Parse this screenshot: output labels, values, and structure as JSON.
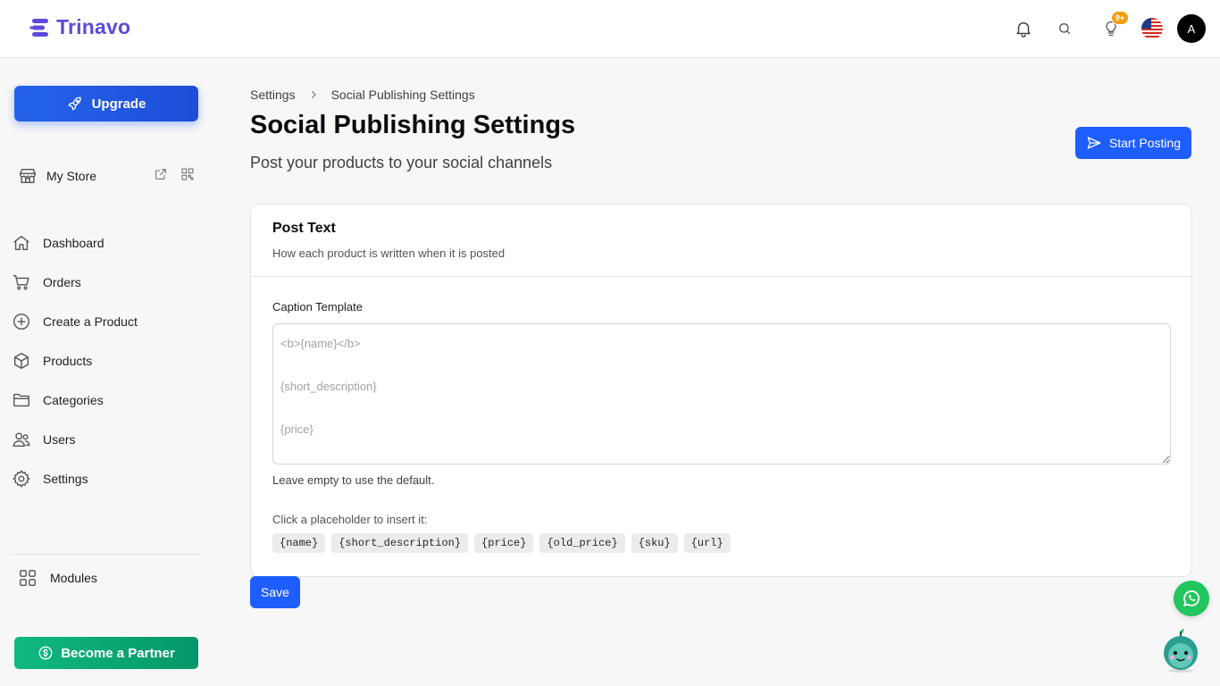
{
  "app": {
    "brand": "Trinavo"
  },
  "topbar": {
    "notifications_badge": "9+",
    "avatar_initial": "A",
    "language_icon": "us-flag-icon"
  },
  "sidebar": {
    "upgrade_label": "Upgrade",
    "store_label": "My Store",
    "items": [
      {
        "label": "Dashboard",
        "icon": "home-icon"
      },
      {
        "label": "Orders",
        "icon": "cart-icon"
      },
      {
        "label": "Create a Product",
        "icon": "plus-circle-icon"
      },
      {
        "label": "Products",
        "icon": "box-icon"
      },
      {
        "label": "Categories",
        "icon": "folder-icon"
      },
      {
        "label": "Users",
        "icon": "users-icon"
      },
      {
        "label": "Settings",
        "icon": "gear-icon"
      }
    ],
    "modules_label": "Modules",
    "partner_label": "Become a Partner"
  },
  "breadcrumb": {
    "parent": "Settings",
    "current": "Social Publishing Settings"
  },
  "page": {
    "title": "Social Publishing Settings",
    "subtitle": "Post your products to your social channels",
    "start_posting_label": "Start Posting"
  },
  "card": {
    "title": "Post Text",
    "description": "How each product is written when it is posted",
    "field_label": "Caption Template",
    "caption_value": "",
    "caption_placeholder": "<b>{name}</b>\n\n{short_description}\n\n{price}",
    "hint": "Leave empty to use the default.",
    "insert_label": "Click a placeholder to insert it:",
    "placeholders": [
      "{name}",
      "{short_description}",
      "{price}",
      "{old_price}",
      "{sku}",
      "{url}"
    ]
  },
  "save_label": "Save",
  "colors": {
    "primary": "#1e5eff",
    "brand": "#5b4bd6",
    "partner": "#10b981",
    "whatsapp": "#22c55e",
    "badge": "#f59e0b"
  }
}
